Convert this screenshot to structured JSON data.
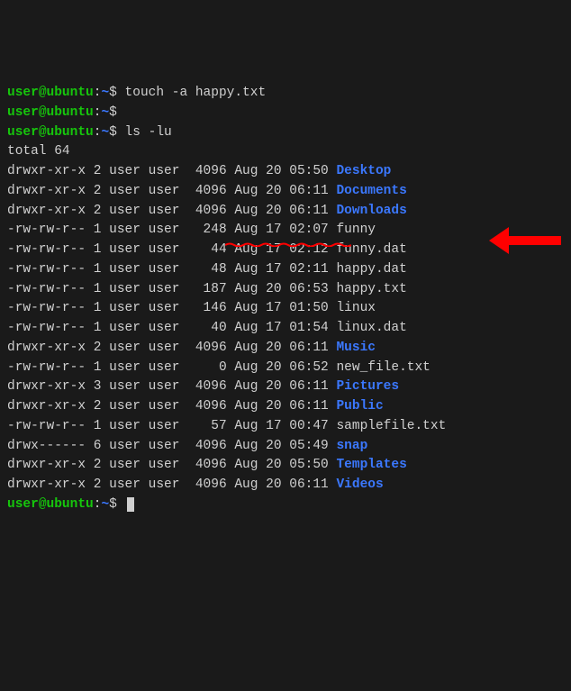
{
  "prompt": {
    "user": "user",
    "at": "@",
    "host": "ubuntu",
    "colon": ":",
    "path": "~",
    "dollar": "$"
  },
  "commands": {
    "c1": " touch -a happy.txt",
    "c2": "",
    "c3": " ls -lu"
  },
  "total_line": "total 64",
  "listing": [
    {
      "perms": "drwxr-xr-x 2 user user  4096 Aug 20 05:50 ",
      "name": "Desktop",
      "type": "dir"
    },
    {
      "perms": "drwxr-xr-x 2 user user  4096 Aug 20 06:11 ",
      "name": "Documents",
      "type": "dir"
    },
    {
      "perms": "drwxr-xr-x 2 user user  4096 Aug 20 06:11 ",
      "name": "Downloads",
      "type": "dir"
    },
    {
      "perms": "-rw-rw-r-- 1 user user   248 Aug 17 02:07 ",
      "name": "funny",
      "type": "file"
    },
    {
      "perms": "-rw-rw-r-- 1 user user    44 Aug 17 02:12 ",
      "name": "funny.dat",
      "type": "file"
    },
    {
      "perms": "-rw-rw-r-- 1 user user    48 Aug 17 02:11 ",
      "name": "happy.dat",
      "type": "file"
    },
    {
      "perms": "-rw-rw-r-- 1 user user   187 Aug 20 06:53 ",
      "name": "happy.txt",
      "type": "file"
    },
    {
      "perms": "-rw-rw-r-- 1 user user   146 Aug 17 01:50 ",
      "name": "linux",
      "type": "file"
    },
    {
      "perms": "-rw-rw-r-- 1 user user    40 Aug 17 01:54 ",
      "name": "linux.dat",
      "type": "file"
    },
    {
      "perms": "drwxr-xr-x 2 user user  4096 Aug 20 06:11 ",
      "name": "Music",
      "type": "dir"
    },
    {
      "perms": "-rw-rw-r-- 1 user user     0 Aug 20 06:52 ",
      "name": "new_file.txt",
      "type": "file"
    },
    {
      "perms": "drwxr-xr-x 3 user user  4096 Aug 20 06:11 ",
      "name": "Pictures",
      "type": "dir"
    },
    {
      "perms": "drwxr-xr-x 2 user user  4096 Aug 20 06:11 ",
      "name": "Public",
      "type": "dir"
    },
    {
      "perms": "-rw-rw-r-- 1 user user    57 Aug 17 00:47 ",
      "name": "samplefile.txt",
      "type": "file"
    },
    {
      "perms": "drwx------ 6 user user  4096 Aug 20 05:49 ",
      "name": "snap",
      "type": "dir"
    },
    {
      "perms": "drwxr-xr-x 2 user user  4096 Aug 20 05:50 ",
      "name": "Templates",
      "type": "dir"
    },
    {
      "perms": "drwxr-xr-x 2 user user  4096 Aug 20 06:11 ",
      "name": "Videos",
      "type": "dir"
    }
  ]
}
